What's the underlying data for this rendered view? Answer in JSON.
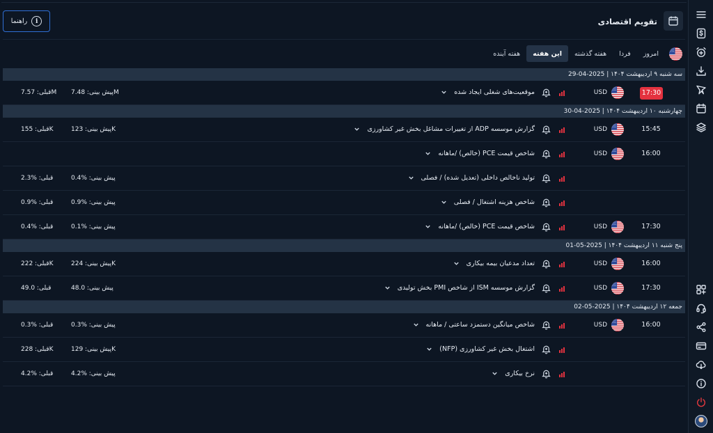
{
  "header": {
    "title": "تقویم اقتصادی",
    "help_label": "راهنما",
    "help_icon_glyph": "i"
  },
  "tabs": [
    {
      "label": "امروز",
      "active": false
    },
    {
      "label": "فردا",
      "active": false
    },
    {
      "label": "هفته گذشته",
      "active": false
    },
    {
      "label": "این هفته",
      "active": true
    },
    {
      "label": "هفته آینده",
      "active": false
    }
  ],
  "colors": {
    "accent": "#2f6fd6",
    "impact_high": "#e4323f",
    "live_badge": "#e4323f",
    "day_header_bg": "#243345",
    "background": "#0d1623"
  },
  "icons": {
    "sidebar_top": [
      "menu-icon",
      "dollar-icon",
      "alarm-add-icon",
      "download-icon",
      "filter-icon",
      "calendar-icon",
      "layers-icon"
    ],
    "sidebar_bottom": [
      "apps-add-icon",
      "support-icon",
      "share-icon",
      "card-icon",
      "cloud-download-icon",
      "info-icon",
      "power-icon"
    ],
    "row": [
      "bell-add-icon",
      "impact-bars-icon",
      "us-flag-icon",
      "chevron-down-icon"
    ]
  },
  "days": [
    {
      "header": "سه شنبه ۹ اردیبهشت ۱۴۰۴ | 2025-04-29",
      "events": [
        {
          "time": "17:30",
          "live": true,
          "currency": "USD",
          "show_flag": true,
          "title": "موقعیت‌های شغلی ایجاد شده",
          "forecast": "پیش بینی: 7.48M",
          "previous": "قبلی: 7.57M"
        }
      ]
    },
    {
      "header": "چهارشنبه ۱۰ اردیبهشت ۱۴۰۴ | 2025-04-30",
      "events": [
        {
          "time": "15:45",
          "live": false,
          "currency": "USD",
          "show_flag": true,
          "title": "گزارش موسسه ADP از تغییرات مشاغل بخش غیر کشاورزی",
          "forecast": "پیش بینی: 123K",
          "previous": "قبلی: 155K"
        },
        {
          "time": "16:00",
          "live": false,
          "currency": "USD",
          "show_flag": true,
          "title": "شاخص قیمت PCE (خالص) /ماهانه",
          "forecast": "",
          "previous": ""
        },
        {
          "time": "",
          "live": false,
          "currency": "",
          "show_flag": false,
          "title": "تولید ناخالص داخلی (تعدیل شده) / فصلی",
          "forecast": "پیش بینی: %0.4",
          "previous": "قبلی: %2.3"
        },
        {
          "time": "",
          "live": false,
          "currency": "",
          "show_flag": false,
          "title": "شاخص هزینه اشتغال / فصلی",
          "forecast": "پیش بینی: %0.9",
          "previous": "قبلی: %0.9"
        },
        {
          "time": "17:30",
          "live": false,
          "currency": "USD",
          "show_flag": true,
          "title": "شاخص قیمت PCE (خالص) /ماهانه",
          "forecast": "پیش بینی: %0.1",
          "previous": "قبلی: %0.4"
        }
      ]
    },
    {
      "header": "پنج شنبه ۱۱ اردیبهشت ۱۴۰۴ | 2025-05-01",
      "events": [
        {
          "time": "16:00",
          "live": false,
          "currency": "USD",
          "show_flag": true,
          "title": "تعداد مدعیان بیمه بیکاری",
          "forecast": "پیش بینی: 224K",
          "previous": "قبلی: 222K"
        },
        {
          "time": "17:30",
          "live": false,
          "currency": "USD",
          "show_flag": true,
          "title": "گزارش موسسه ISM از شاخص PMI بخش تولیدی",
          "forecast": "پیش بینی: 48.0",
          "previous": "قبلی: 49.0"
        }
      ]
    },
    {
      "header": "جمعه ۱۲ اردیبهشت ۱۴۰۴ | 2025-05-02",
      "events": [
        {
          "time": "16:00",
          "live": false,
          "currency": "USD",
          "show_flag": true,
          "title": "شاخص میانگین دستمزد ساعتی / ماهانه",
          "forecast": "پیش بینی: %0.3",
          "previous": "قبلی: %0.3"
        },
        {
          "time": "",
          "live": false,
          "currency": "",
          "show_flag": false,
          "title": "اشتغال بخش غیر کشاورزی (NFP)",
          "forecast": "پیش بینی: 129K",
          "previous": "قبلی: 228K"
        },
        {
          "time": "",
          "live": false,
          "currency": "",
          "show_flag": false,
          "title": "نرخ بیکاری",
          "forecast": "پیش بینی: %4.2",
          "previous": "قبلی: %4.2"
        }
      ]
    }
  ]
}
